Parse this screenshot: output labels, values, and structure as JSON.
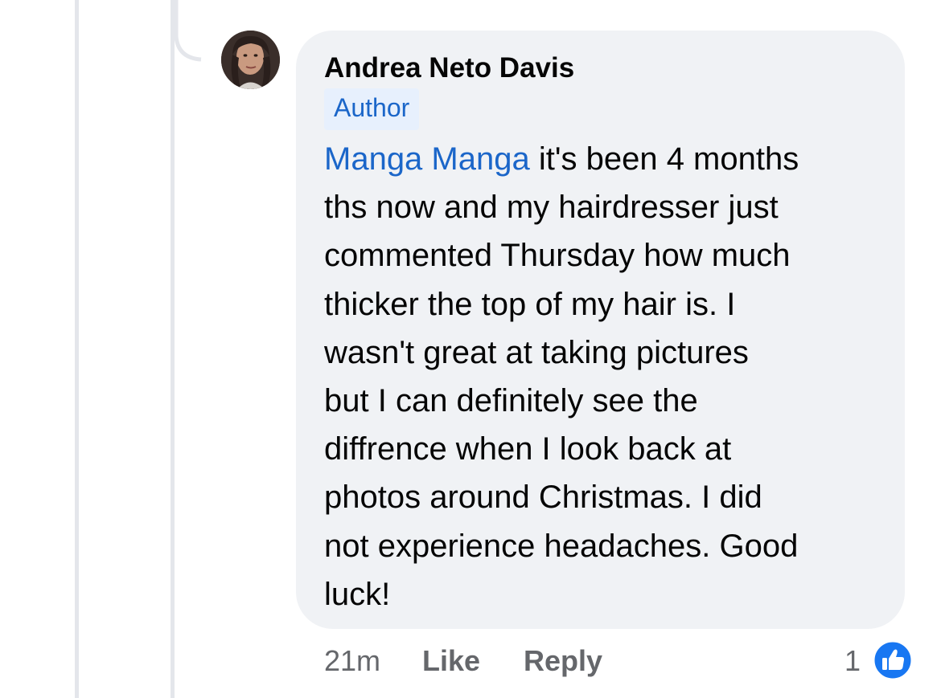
{
  "comment": {
    "author_name": "Andrea Neto Davis",
    "author_badge": "Author",
    "mention": "Manga Manga",
    "text_lines": [
      " it's been 4 months",
      "ths now and my hairdresser just",
      "commented Thursday how much",
      "thicker the top of my hair is. I",
      "wasn't great at taking pictures",
      "but I can definitely see the",
      "diffrence when I look back at",
      "photos around Christmas. I did",
      "not experience headaches. Good",
      "luck!"
    ],
    "timestamp": "21m",
    "like_label": "Like",
    "reply_label": "Reply",
    "reaction_count": "1",
    "reaction_icon": "thumbs-up-icon"
  },
  "colors": {
    "bubble_bg": "#f0f2f5",
    "link_blue": "#1b66c9",
    "badge_bg": "#e7f0fd",
    "meta_gray": "#65676b",
    "reaction_blue": "#1877f2",
    "thread_line": "#e4e6eb"
  }
}
